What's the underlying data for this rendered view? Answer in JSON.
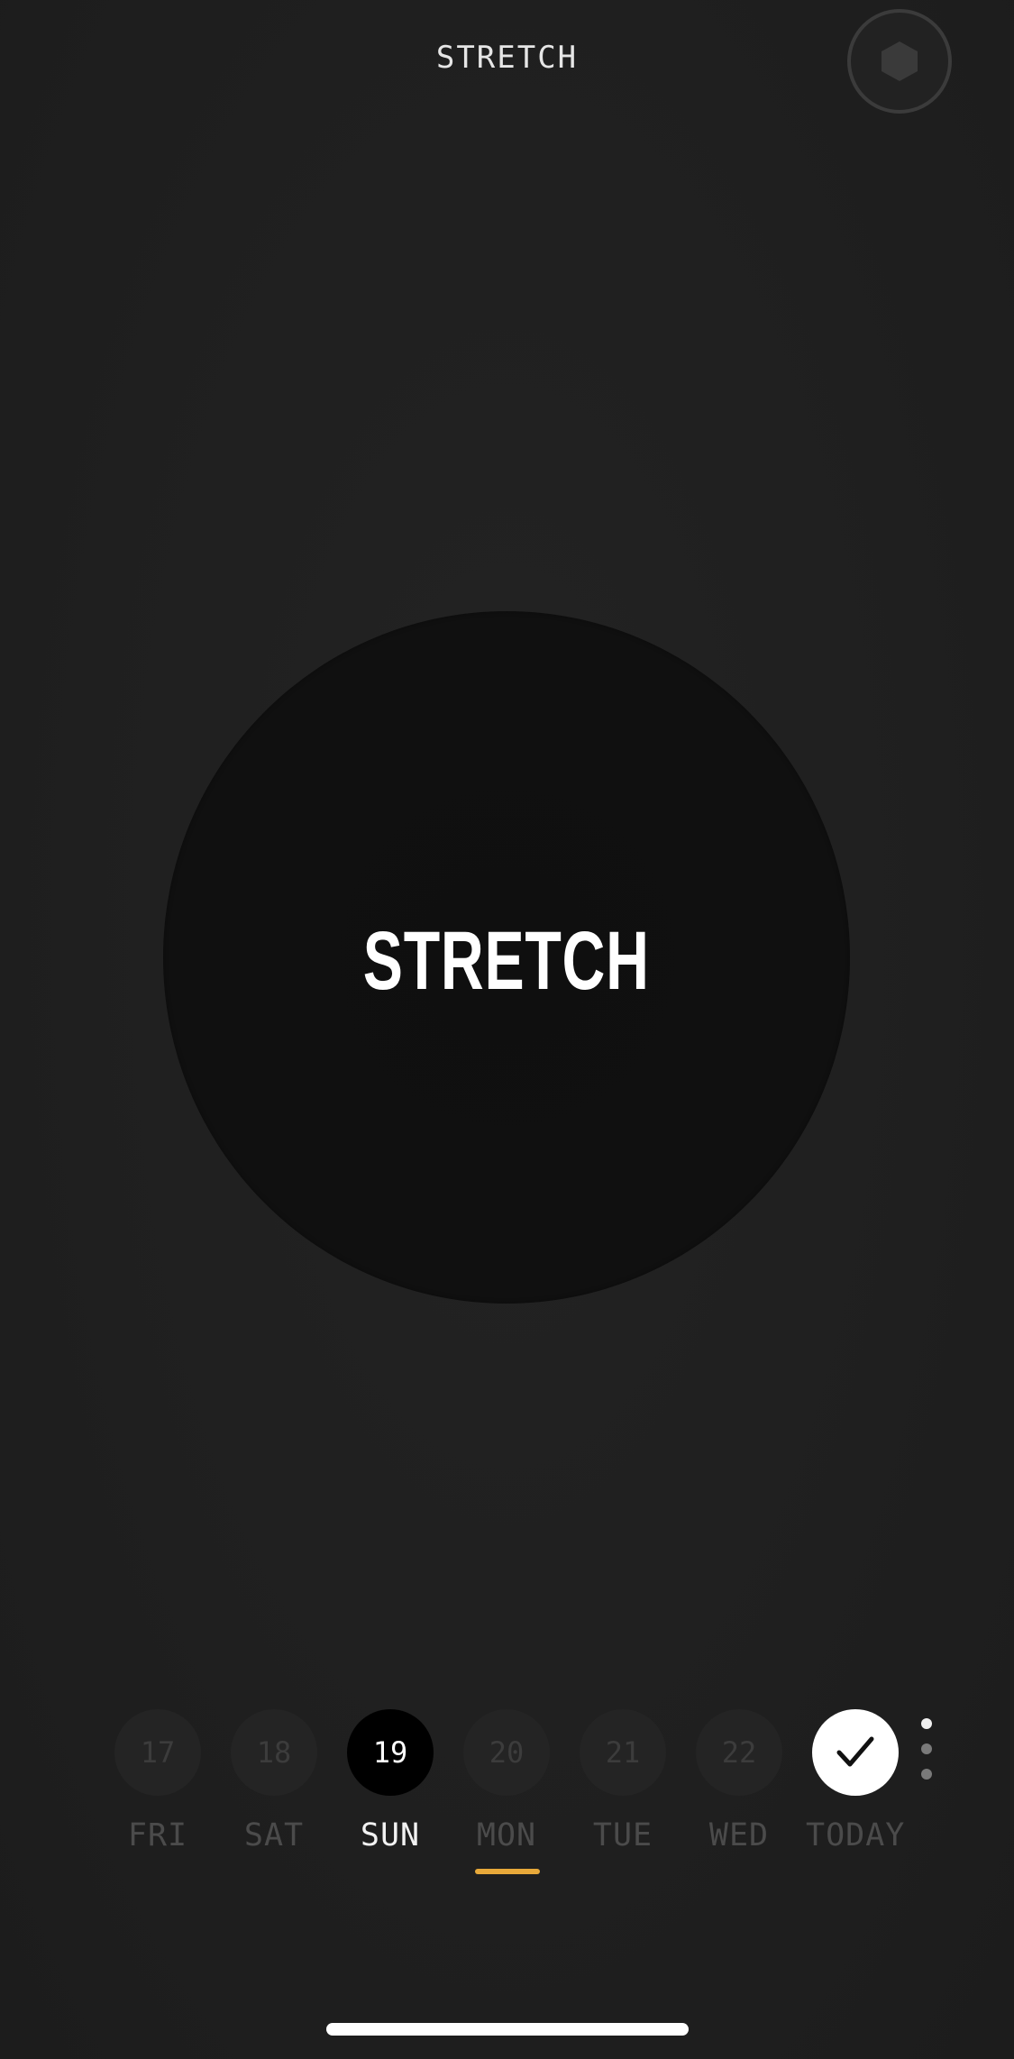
{
  "header": {
    "title": "STRETCH",
    "badge_icon": "hexagon-icon"
  },
  "main": {
    "label": "STRETCH"
  },
  "days": [
    {
      "number": "17",
      "label": "FRI",
      "state": "inactive"
    },
    {
      "number": "18",
      "label": "SAT",
      "state": "inactive"
    },
    {
      "number": "19",
      "label": "SUN",
      "state": "selected"
    },
    {
      "number": "20",
      "label": "MON",
      "state": "inactive"
    },
    {
      "number": "21",
      "label": "TUE",
      "state": "inactive"
    },
    {
      "number": "22",
      "label": "WED",
      "state": "inactive"
    },
    {
      "number": "",
      "label": "TODAY",
      "state": "completed",
      "icon": "checkmark-icon"
    }
  ],
  "colors": {
    "background": "#1e1e1e",
    "accent_underline": "#e8a93a",
    "selected_day": "#000000",
    "today_circle": "#ffffff"
  },
  "more_menu_icon": "vertical-dots-icon"
}
